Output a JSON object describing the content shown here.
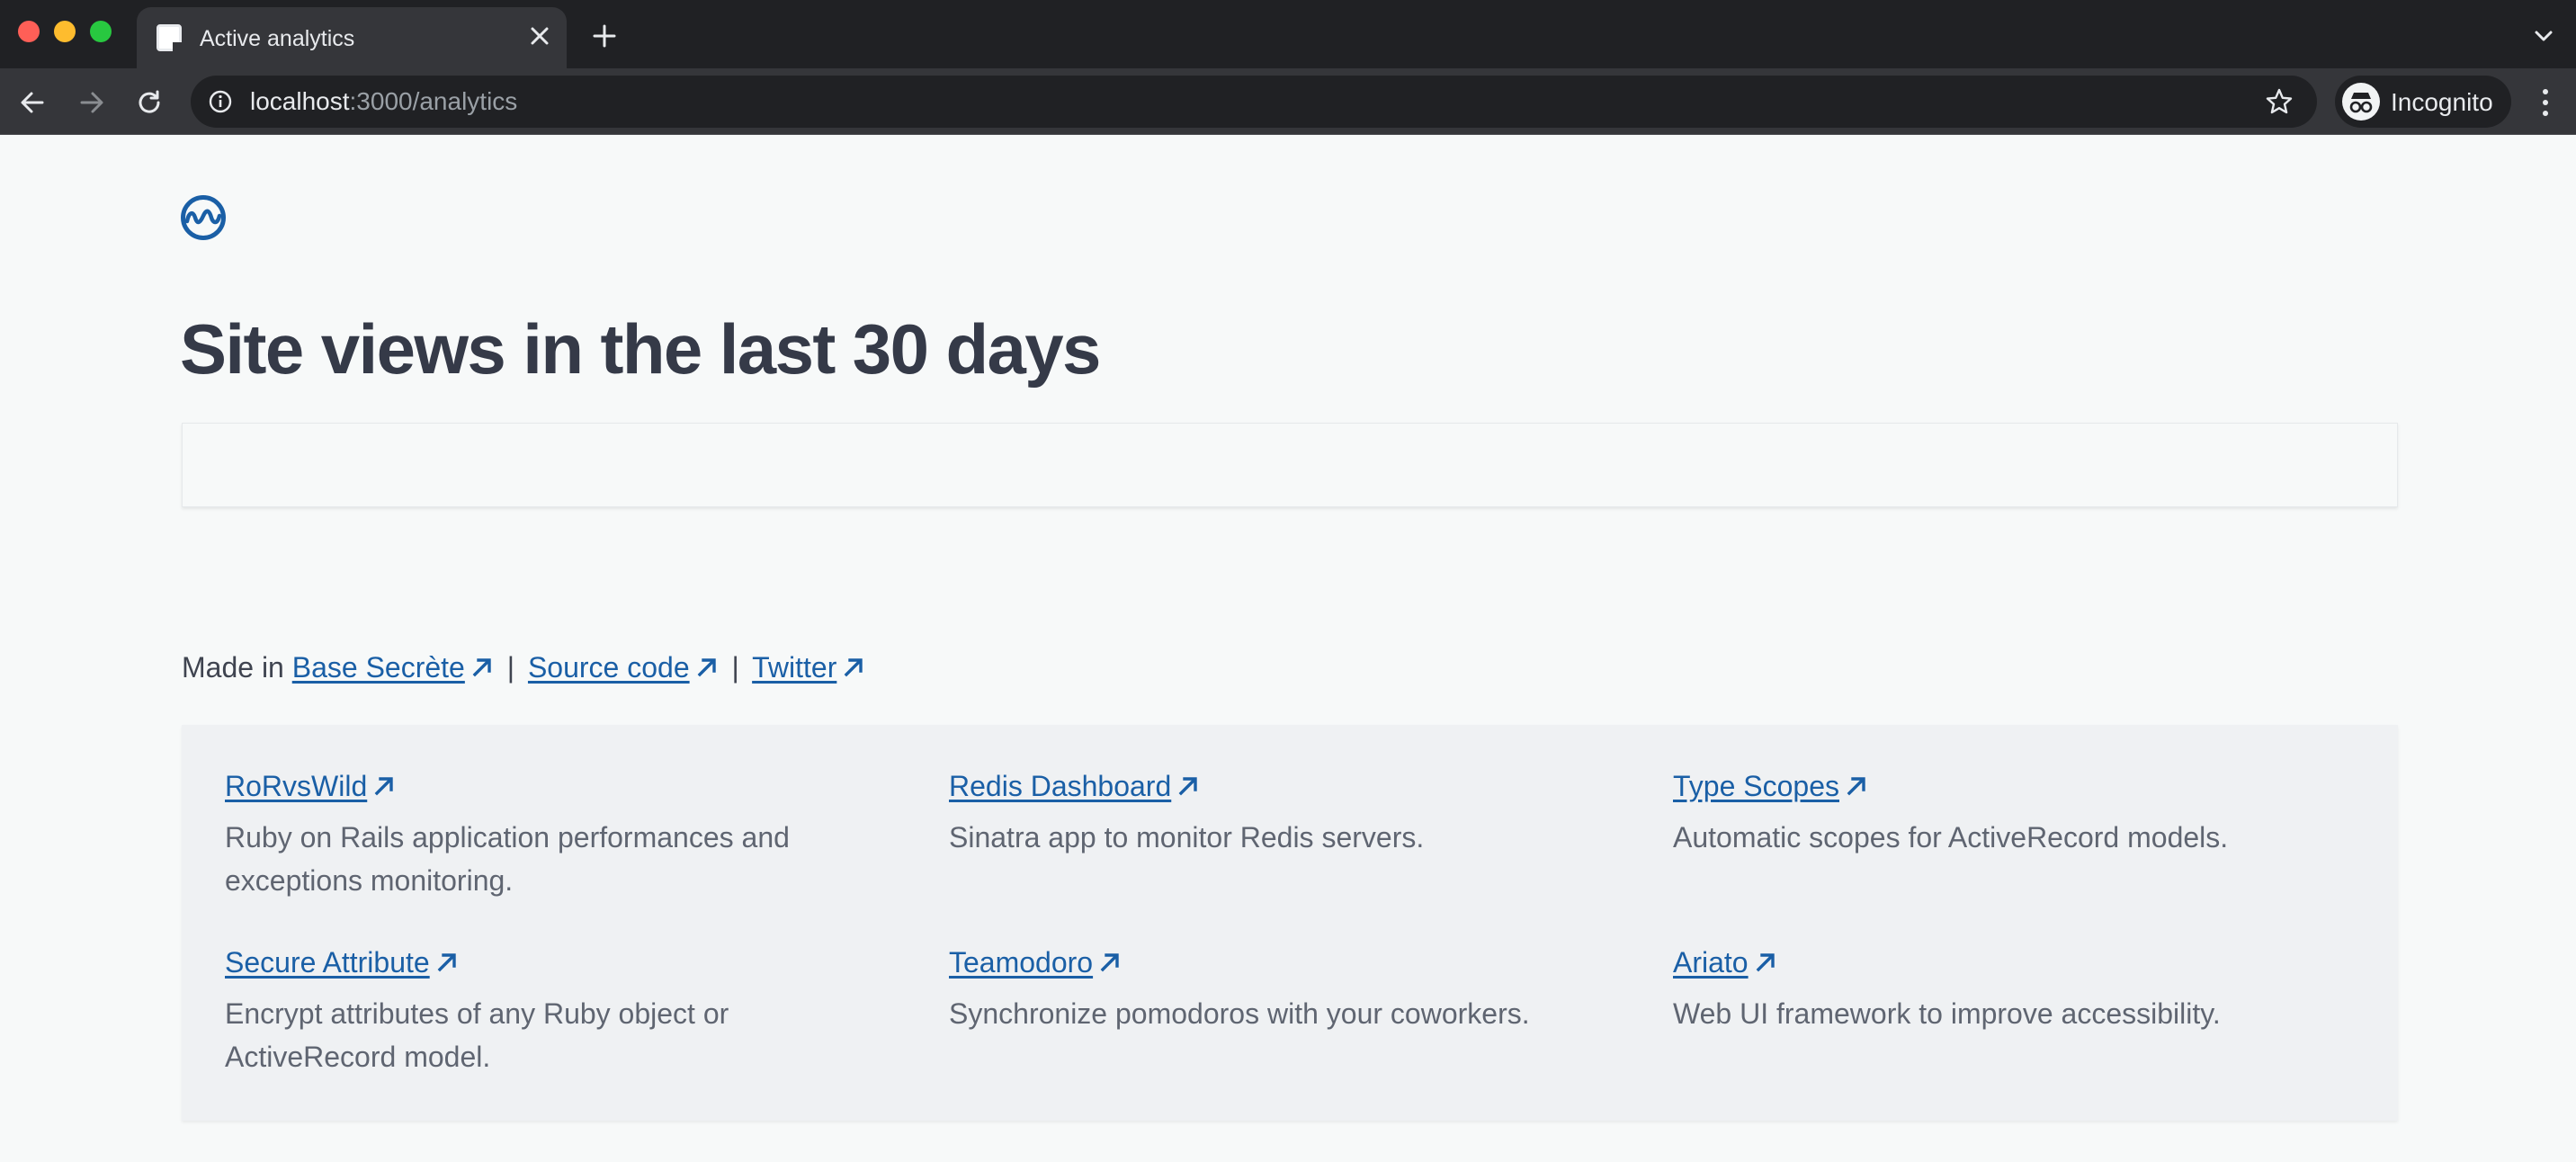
{
  "browser": {
    "tab_title": "Active analytics",
    "url_host": "localhost",
    "url_path": ":3000/analytics",
    "profile_label": "Incognito"
  },
  "page": {
    "title": "Site views in the last 30 days",
    "footer": {
      "prefix": "Made in",
      "links": [
        "Base Secrète",
        "Source code",
        "Twitter"
      ],
      "separator": "|"
    },
    "projects": [
      {
        "name": "RoRvsWild",
        "description": "Ruby on Rails application performances and exceptions monitoring."
      },
      {
        "name": "Redis Dashboard",
        "description": "Sinatra app to monitor Redis servers."
      },
      {
        "name": "Type Scopes",
        "description": "Automatic scopes for ActiveRecord models."
      },
      {
        "name": "Secure Attribute",
        "description": "Encrypt attributes of any Ruby object or ActiveRecord model."
      },
      {
        "name": "Teamodoro",
        "description": "Synchronize pomodoros with your coworkers."
      },
      {
        "name": "Ariato",
        "description": "Web UI framework to improve accessibility."
      }
    ]
  },
  "colors": {
    "link": "#1a5fa6",
    "heading": "#353a48",
    "page_background": "#f7f9f9",
    "panel_background": "#eff1f3"
  },
  "icons": {
    "logo": "wave-circle-logo",
    "external_link": "arrow-up-right-icon"
  }
}
